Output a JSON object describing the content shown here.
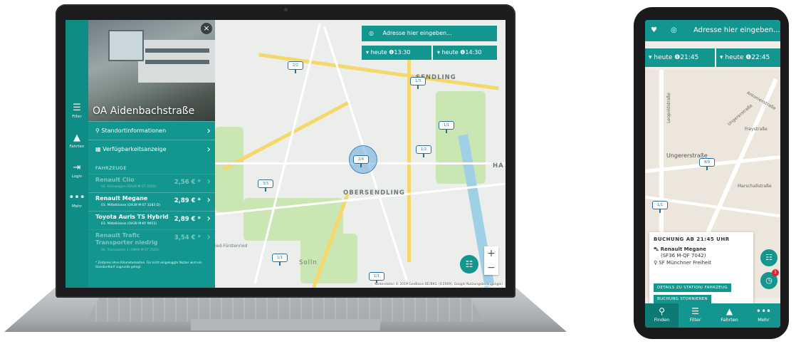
{
  "laptop": {
    "rail": [
      {
        "icon": "filter-icon",
        "glyph": "☰",
        "label": "Filter"
      },
      {
        "icon": "booking-icon",
        "glyph": "▲",
        "label": "Fahrten"
      },
      {
        "icon": "login-icon",
        "glyph": "⇥",
        "label": "Login"
      },
      {
        "icon": "more-icon",
        "glyph": "•••",
        "label": "Mehr"
      }
    ],
    "station_title": "OA Aidenbachstraße",
    "close_glyph": "×",
    "rows": [
      {
        "glyph": "⚲",
        "label": "Standortinformationen"
      },
      {
        "glyph": "▦",
        "label": "Verfügbarkeitsanzeige"
      }
    ],
    "section_label": "FAHRZEUGE",
    "vehicles": [
      {
        "name": "Renault Clio",
        "sub": "02. Kleinwagen (OA39 M-ST 3245)",
        "price": "2,56 € *",
        "available": false
      },
      {
        "name": "Renault Megane",
        "sub": "03. Mittelklasse (OA39 M-ST 3283 D)",
        "price": "2,89 € *",
        "available": true
      },
      {
        "name": "Toyota Auris TS Hybrid",
        "sub": "03. Mittelklasse (OA39 M-KY 9053)",
        "price": "2,89 € *",
        "available": true
      },
      {
        "name": "Renault Trafic Transporter niedrig",
        "sub": "06. Transporter 3 (SM49 M-ST 2562)",
        "price": "3,54 € *",
        "available": false
      }
    ],
    "footnote": "* Zeitpreis ohne Kilometerkosten. Für nicht eingeloggte Nutzer wird ein Standardtarif zugrunde gelegt.",
    "search_placeholder": "Adresse hier eingeben...",
    "time_from": "heute ❶13:30",
    "time_to": "heute ❶14:30",
    "map_labels": [
      "SENDLING",
      "OBERSENDLING",
      "Solln",
      "HA",
      "ied-Fürstenried"
    ],
    "pins": [
      "2/2",
      "1/3",
      "1/1",
      "1/2",
      "2/4",
      "3/3",
      "1/1",
      "1/1"
    ],
    "attribution": "Kartendaten © 2019 GeoBasis-DE/BKG (©2009), Google   Nutzungsbedingungen",
    "zoom_in": "+",
    "zoom_out": "−"
  },
  "phone": {
    "search_placeholder": "Adresse hier eingeben...",
    "time_from": "heute ❶21:45",
    "time_to": "heute ❶22:45",
    "street_labels": [
      "Ungererstraße",
      "Leopoldstraße",
      "Freystraße",
      "Marschallstraße",
      "Ungererstraße",
      "Antonienstraße"
    ],
    "pins": [
      "8/9",
      "1/1"
    ],
    "booking_title": "BUCHUNG AB 21:45 UHR",
    "car_name": "Renault Megane",
    "car_plate": "(SF36 M-QF 7042)",
    "station": "SF Münchner Freiheit",
    "btn_details": "DETAILS ZU STATION/ FAHRZEUG",
    "btn_cancel": "BUCHUNG STORNIEREN",
    "badge_count": "1",
    "nav": [
      {
        "icon": "find-icon",
        "glyph": "⚲",
        "label": "Finden"
      },
      {
        "icon": "filter-icon",
        "glyph": "☰",
        "label": "Filter"
      },
      {
        "icon": "booking-icon",
        "glyph": "▲",
        "label": "Fahrten"
      },
      {
        "icon": "more-icon",
        "glyph": "•••",
        "label": "Mehr"
      }
    ]
  },
  "colors": {
    "brand": "#13968f",
    "rail": "#0f8c86",
    "pin": "#2a6f9a"
  }
}
